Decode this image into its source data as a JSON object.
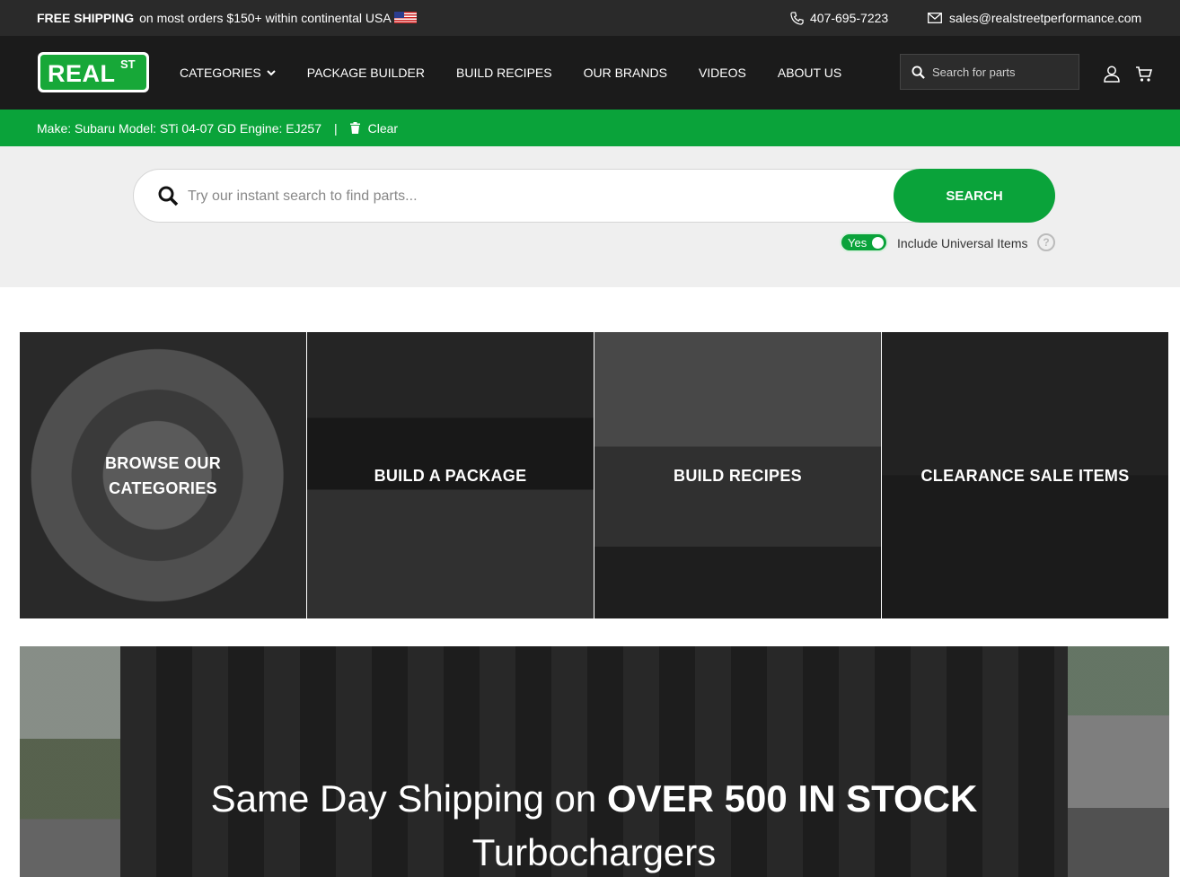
{
  "topbar": {
    "shipping_bold": "FREE SHIPPING",
    "shipping_text": "on most orders $150+ within continental USA",
    "phone": "407-695-7223",
    "email": "sales@realstreetperformance.com"
  },
  "nav": {
    "logo_word": "REAL",
    "logo_super": "ST",
    "items": [
      {
        "label": "CATEGORIES",
        "has_dropdown": true
      },
      {
        "label": "PACKAGE BUILDER"
      },
      {
        "label": "BUILD RECIPES"
      },
      {
        "label": "OUR BRANDS"
      },
      {
        "label": "VIDEOS"
      },
      {
        "label": "ABOUT US"
      }
    ],
    "search_placeholder": "Search for parts"
  },
  "vehicle": {
    "text": "Make: Subaru Model: STi 04-07 GD Engine: EJ257",
    "separator": "|",
    "clear_label": "Clear"
  },
  "search": {
    "placeholder": "Try our instant search to find parts...",
    "button_label": "SEARCH",
    "toggle_label": "Yes",
    "toggle_on": true,
    "universal_label": "Include Universal Items",
    "help_glyph": "?"
  },
  "tiles": [
    {
      "label": "BROWSE OUR CATEGORIES"
    },
    {
      "label": "BUILD A PACKAGE"
    },
    {
      "label": "BUILD RECIPES"
    },
    {
      "label": "CLEARANCE SALE ITEMS"
    }
  ],
  "banner": {
    "line1_light": "Same Day Shipping on",
    "line1_bold": "OVER 500 IN STOCK",
    "line2": "Turbochargers"
  },
  "colors": {
    "brand_green": "#0aa33a",
    "topbar_bg": "#2a2a2a",
    "nav_bg": "#1b1b1b"
  }
}
